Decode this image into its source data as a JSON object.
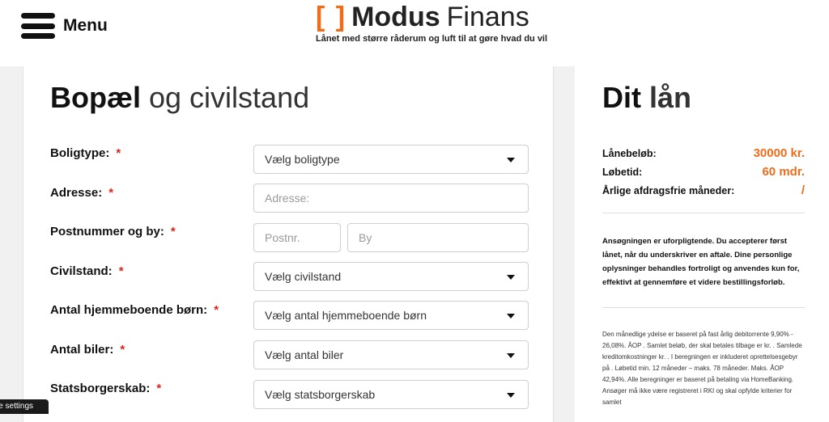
{
  "header": {
    "menu_label": "Menu",
    "logo_bracket": "[ ]",
    "logo_modus": "Modus",
    "logo_finans": "Finans",
    "tagline": "Lånet med større råderum og luft til at gøre hvad du vil"
  },
  "form": {
    "title_bold": "Bopæl",
    "title_light": "og civilstand",
    "required_mark": "*",
    "fields": {
      "boligtype": {
        "label": "Boligtype:",
        "value": "Vælg boligtype"
      },
      "adresse": {
        "label": "Adresse:",
        "placeholder": "Adresse:"
      },
      "postnummer": {
        "label": "Postnummer og by:",
        "postnr_placeholder": "Postnr.",
        "by_placeholder": "By"
      },
      "civilstand": {
        "label": "Civilstand:",
        "value": "Vælg civilstand"
      },
      "boern": {
        "label": "Antal hjemmeboende børn:",
        "value": "Vælg antal hjemmeboende børn"
      },
      "biler": {
        "label": "Antal biler:",
        "value": "Vælg antal biler"
      },
      "statsborgerskab": {
        "label": "Statsborgerskab:",
        "value": "Vælg statsborgerskab"
      }
    }
  },
  "loan": {
    "title_bold": "Dit",
    "title_light": "lån",
    "amount_label": "Lånebeløb:",
    "amount_value": "30000 kr.",
    "term_label": "Løbetid:",
    "term_value": "60 mdr.",
    "free_months_label": "Årlige afdragsfrie måneder:",
    "free_months_value": "/",
    "disclaimer": "Ansøgningen er uforpligtende. Du accepterer først lånet, når du underskriver en aftale. Dine personlige oplysninger behandles fortroligt og anvendes kun for, effektivt at gennemføre et videre bestillingsforløb.",
    "smallprint": "Den månedlige ydelse er baseret på fast årlig debitorrente 9,90% - 26,08%. ÅOP . Samlet beløb, der skal betales tilbage er kr. . Samlede kreditomkostninger kr. . I beregningen er inkluderet oprettelsesgebyr på . Løbetid min. 12 måneder – maks. 78 måneder. Maks. ÅOP 42,94%. Alle beregninger er baseret på betaling via HomeBanking. Ansøger må ikke være registreret i RKI og skal opfylde kriterier for samlet"
  },
  "cookie": {
    "label": "ie settings"
  },
  "colors": {
    "accent": "#ef6c1a",
    "required": "#e0241b"
  }
}
